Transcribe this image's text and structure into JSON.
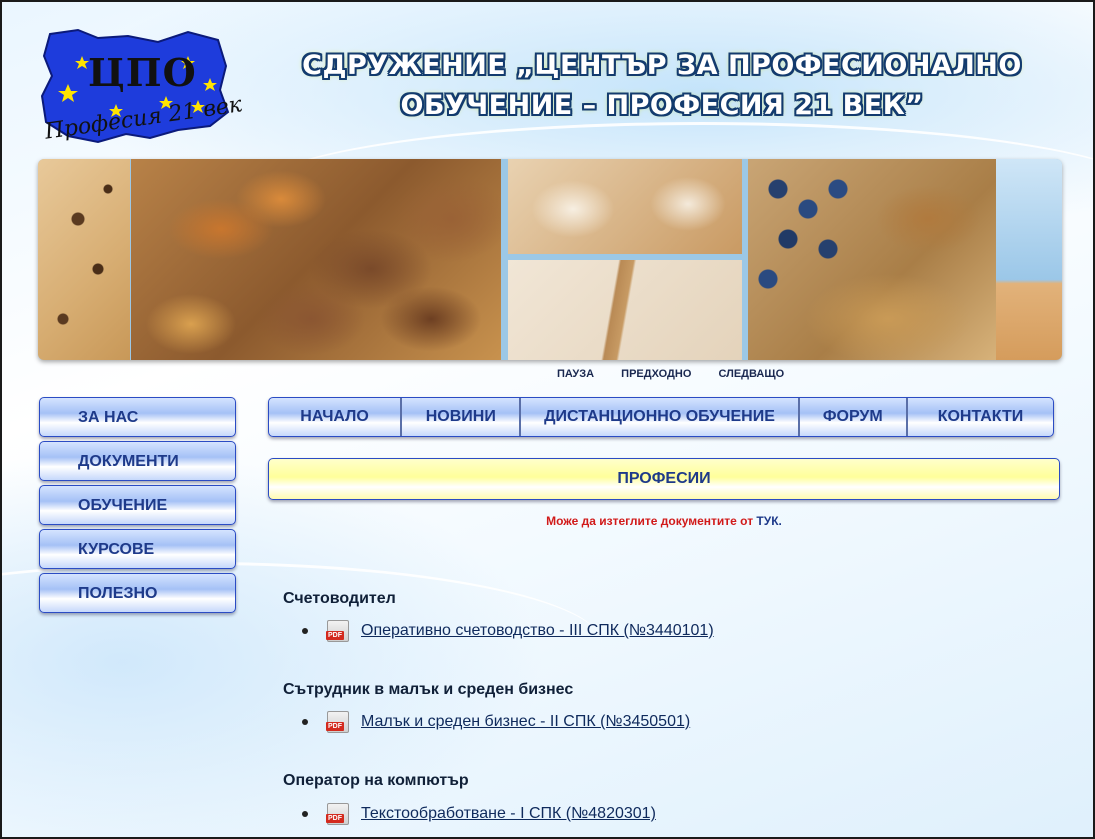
{
  "header": {
    "logo_text": "ЦПО",
    "logo_subtext": "Професия 21 век",
    "title_line1": "СДРУЖЕНИЕ „ЦЕНТЪР ЗА ПРОФЕСИОНАЛНО",
    "title_line2": "ОБУЧЕНИЕ – ПРОФЕСИЯ 21 ВЕК”"
  },
  "slider": {
    "pause": "ПАУЗА",
    "prev": "ПРЕДХОДНО",
    "next": "СЛЕДВАЩО"
  },
  "sidebar": {
    "items": [
      {
        "label": "ЗА НАС"
      },
      {
        "label": "ДОКУМЕНТИ"
      },
      {
        "label": "ОБУЧЕНИЕ"
      },
      {
        "label": "КУРСОВЕ"
      },
      {
        "label": "ПОЛЕЗНО"
      }
    ]
  },
  "topnav": {
    "items": [
      {
        "label": "НАЧАЛО"
      },
      {
        "label": "НОВИНИ"
      },
      {
        "label": "ДИСТАНЦИОННО ОБУЧЕНИЕ"
      },
      {
        "label": "ФОРУМ"
      },
      {
        "label": "КОНТАКТИ"
      }
    ]
  },
  "main": {
    "section_header": "ПРОФЕСИИ",
    "notice_text": "Може да изтеглите документите от ",
    "notice_link": "ТУК",
    "notice_end": ".",
    "professions": [
      {
        "title": "Счетоводител",
        "document": "Оперативно счетоводство - III СПК (№3440101)"
      },
      {
        "title": "Сътрудник в малък и среден бизнес",
        "document": "Малък и среден бизнес - II СПК (№3450501)"
      },
      {
        "title": "Оператор на компютър",
        "document": "Текстообработване - I СПК (№4820301)"
      }
    ]
  },
  "colors": {
    "nav_text": "#1e3a8a",
    "notice_red": "#d11a1a",
    "title_outline": "#133b6e"
  }
}
